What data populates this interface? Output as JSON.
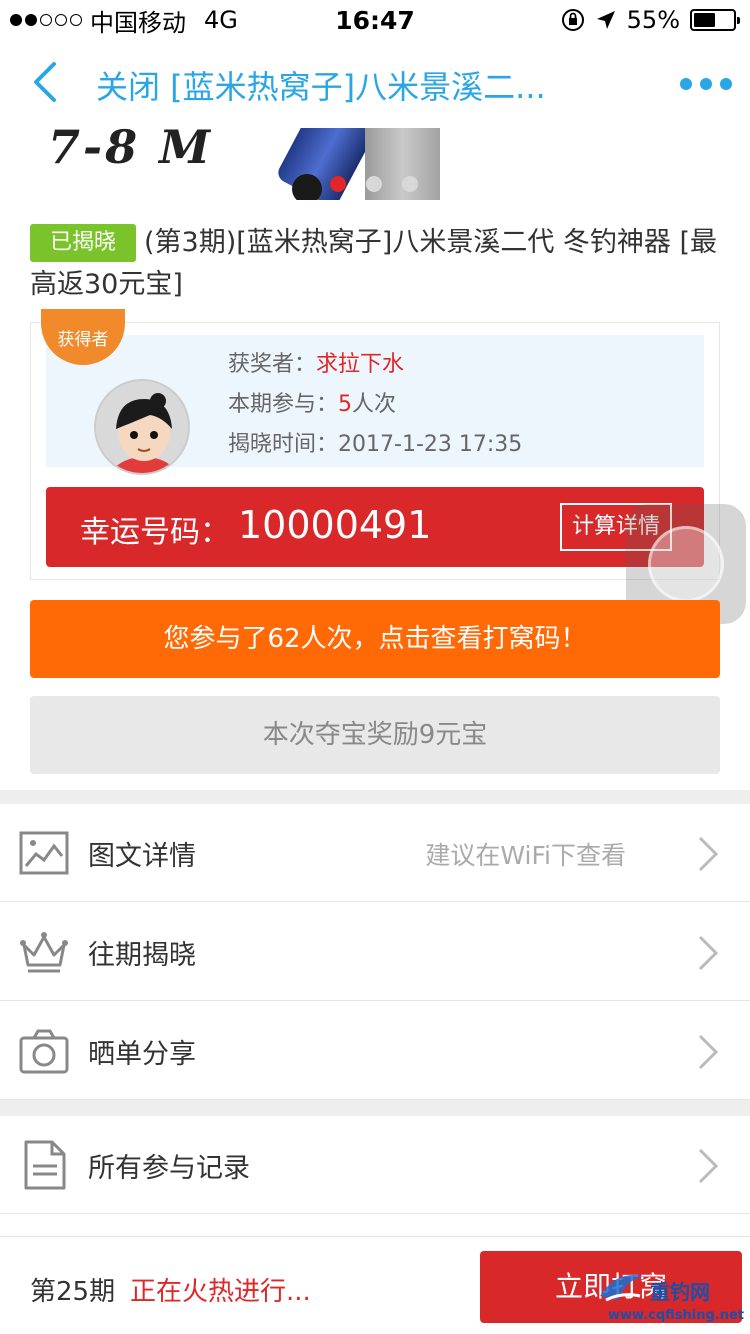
{
  "status_bar": {
    "carrier": "中国移动",
    "network": "4G",
    "time": "16:47",
    "battery_percent": "55%",
    "battery_level": 0.55
  },
  "nav": {
    "title": "关闭 [蓝米热窝子]八米景溪二..."
  },
  "banner": {
    "text": "7-8 M",
    "pages": 3,
    "active_page": 0
  },
  "product": {
    "tag": "已揭晓",
    "title": "(第3期)[蓝米热窝子]八米景溪二代 冬钓神器 [最高返30元宝]"
  },
  "winner": {
    "badge": "获得者",
    "winner_label": "获奖者：",
    "winner_name": "求拉下水",
    "participation_label": "本期参与：",
    "participation_count": "5",
    "participation_unit": "人次",
    "reveal_label": "揭晓时间：",
    "reveal_time": "2017-1-23 17:35",
    "lucky_label": "幸运号码：",
    "lucky_number": "10000491",
    "calc_button": "计算详情"
  },
  "actions": {
    "participated": "您参与了62人次，点击查看打窝码！",
    "reward": "本次夺宝奖励9元宝"
  },
  "list": {
    "items": [
      {
        "label": "图文详情",
        "hint": "建议在WiFi下查看",
        "icon": "image-icon"
      },
      {
        "label": "往期揭晓",
        "hint": "",
        "icon": "crown-icon"
      },
      {
        "label": "晒单分享",
        "hint": "",
        "icon": "camera-icon"
      },
      {
        "label": "所有参与记录",
        "hint": "",
        "icon": "document-icon"
      }
    ]
  },
  "bottom": {
    "period": "第25期",
    "status": "正在火热进行...",
    "button": "立即打窝"
  },
  "watermark": {
    "name": "重钓网",
    "url": "www.cqfishing.net"
  },
  "colors": {
    "accent_blue": "#2aa6e6",
    "red": "#d8282a",
    "orange": "#ff6a06",
    "green_tag": "#7bc32a"
  }
}
